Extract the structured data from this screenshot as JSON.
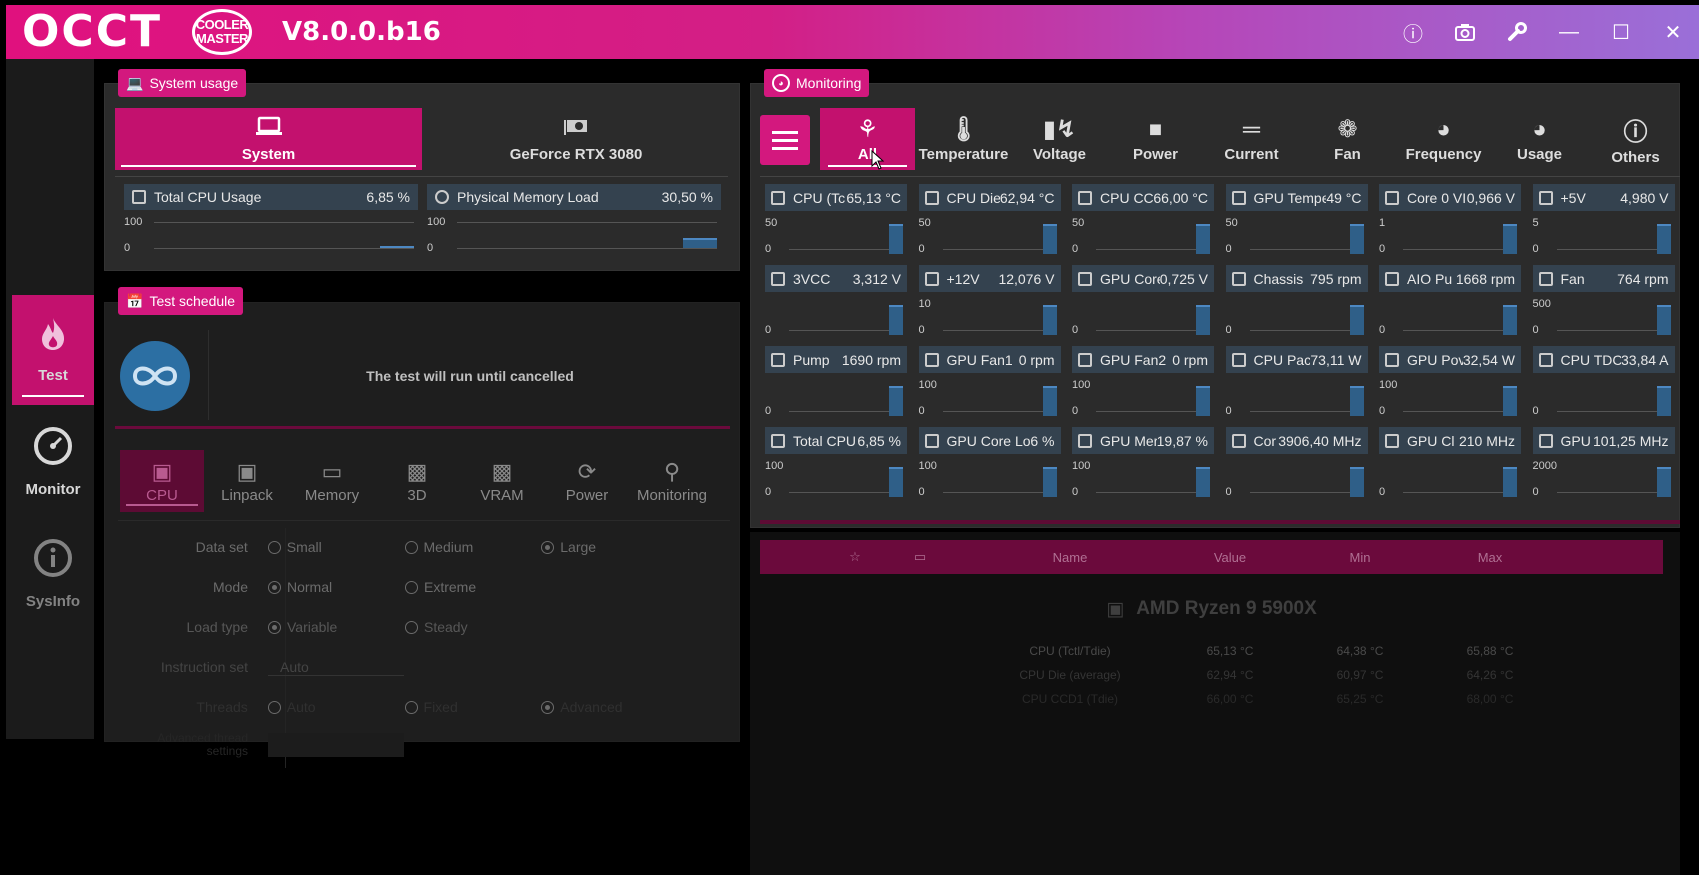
{
  "app": {
    "logo": "OCCT",
    "partner_logo": "COOLER MASTER",
    "version": "V8.0.0.b16"
  },
  "titlebar_icons": [
    "info-icon",
    "camera-icon",
    "wrench-icon",
    "minimize-icon",
    "maximize-icon",
    "close-icon"
  ],
  "sidebar": [
    {
      "label": "Test",
      "icon": "flame-icon",
      "active": true
    },
    {
      "label": "Monitor",
      "icon": "gauge-icon",
      "active": false
    },
    {
      "label": "SysInfo",
      "icon": "info-icon",
      "active": false
    }
  ],
  "system_usage": {
    "title": "System usage",
    "tabs": [
      {
        "label": "System",
        "active": true
      },
      {
        "label": "GeForce RTX 3080",
        "active": false
      }
    ],
    "meters": [
      {
        "label": "Total CPU Usage",
        "value": "6,85 %",
        "axis_max": "100",
        "axis_min": "0"
      },
      {
        "label": "Physical Memory Load",
        "value": "30,50 %",
        "axis_max": "100",
        "axis_min": "0"
      }
    ]
  },
  "test_schedule": {
    "title": "Test schedule",
    "message": "The test will run until cancelled",
    "tabs": [
      {
        "label": "CPU",
        "icon": "chip-icon",
        "active": true
      },
      {
        "label": "Linpack",
        "icon": "chip-icon"
      },
      {
        "label": "Memory",
        "icon": "memory-icon"
      },
      {
        "label": "3D",
        "icon": "gpu-icon"
      },
      {
        "label": "VRAM",
        "icon": "gpu-icon"
      },
      {
        "label": "Power",
        "icon": "power-icon"
      },
      {
        "label": "Monitoring",
        "icon": "magnifier-icon"
      }
    ],
    "options": [
      {
        "label": "Data set",
        "choices": [
          "Small",
          "Medium",
          "Large"
        ],
        "selected": "Large"
      },
      {
        "label": "Mode",
        "choices": [
          "Normal",
          "Extreme"
        ],
        "selected": "Normal"
      },
      {
        "label": "Load type",
        "choices": [
          "Variable",
          "Steady"
        ],
        "selected": "Variable"
      },
      {
        "label": "Instruction set",
        "value": "Auto"
      },
      {
        "label": "Threads",
        "choices": [
          "Auto",
          "Fixed",
          "Advanced"
        ],
        "selected": "Advanced"
      },
      {
        "label": "Advanced thread settings"
      }
    ]
  },
  "monitoring": {
    "title": "Monitoring",
    "tabs": [
      {
        "label": "All",
        "icon": "all-icon",
        "active": true
      },
      {
        "label": "Temperature",
        "icon": "thermometer-icon"
      },
      {
        "label": "Voltage",
        "icon": "battery-icon"
      },
      {
        "label": "Power",
        "icon": "plug-icon"
      },
      {
        "label": "Current",
        "icon": "current-icon"
      },
      {
        "label": "Fan",
        "icon": "fan-icon"
      },
      {
        "label": "Frequency",
        "icon": "speedometer-icon"
      },
      {
        "label": "Usage",
        "icon": "gauge-icon"
      },
      {
        "label": "Others",
        "icon": "question-icon"
      }
    ],
    "sensors": [
      {
        "label": "CPU (Tc",
        "value": "65,13 °C",
        "ax_top": "50",
        "ax_bot": "0"
      },
      {
        "label": "CPU Die",
        "value": "62,94 °C",
        "ax_top": "50",
        "ax_bot": "0"
      },
      {
        "label": "CPU CCI",
        "value": "66,00 °C",
        "ax_top": "50",
        "ax_bot": "0"
      },
      {
        "label": "GPU Tempe",
        "value": "49 °C",
        "ax_top": "50",
        "ax_bot": "0"
      },
      {
        "label": "Core 0 VI",
        "value": "0,966 V",
        "ax_top": "1",
        "ax_bot": "0"
      },
      {
        "label": "+5V",
        "value": "4,980 V",
        "ax_top": "5",
        "ax_bot": "0"
      },
      {
        "label": "3VCC",
        "value": "3,312 V",
        "ax_top": "",
        "ax_bot": "0"
      },
      {
        "label": "+12V",
        "value": "12,076 V",
        "ax_top": "10",
        "ax_bot": "0"
      },
      {
        "label": "GPU Core",
        "value": "0,725 V",
        "ax_top": "",
        "ax_bot": "0"
      },
      {
        "label": "Chassis",
        "value": "795 rpm",
        "ax_top": "",
        "ax_bot": "0"
      },
      {
        "label": "AIO Pu",
        "value": "1668 rpm",
        "ax_top": "",
        "ax_bot": "0"
      },
      {
        "label": "Fan",
        "value": "764 rpm",
        "ax_top": "500",
        "ax_bot": "0"
      },
      {
        "label": "Pump",
        "value": "1690 rpm",
        "ax_top": "",
        "ax_bot": "0"
      },
      {
        "label": "GPU Fan1",
        "value": "0 rpm",
        "ax_top": "100",
        "ax_bot": "0"
      },
      {
        "label": "GPU Fan2",
        "value": "0 rpm",
        "ax_top": "100",
        "ax_bot": "0"
      },
      {
        "label": "CPU Pac",
        "value": "73,11 W",
        "ax_top": "",
        "ax_bot": "0"
      },
      {
        "label": "GPU Pov",
        "value": "32,54 W",
        "ax_top": "100",
        "ax_bot": "0"
      },
      {
        "label": "CPU TDC",
        "value": "33,84 A",
        "ax_top": "",
        "ax_bot": "0"
      },
      {
        "label": "Total CPU",
        "value": "6,85 %",
        "ax_top": "100",
        "ax_bot": "0"
      },
      {
        "label": "GPU Core Lo",
        "value": "6 %",
        "ax_top": "100",
        "ax_bot": "0"
      },
      {
        "label": "GPU Mer",
        "value": "19,87 %",
        "ax_top": "100",
        "ax_bot": "0"
      },
      {
        "label": "Cor",
        "value": "3906,40 MHz",
        "ax_top": "",
        "ax_bot": "0"
      },
      {
        "label": "GPU Cl",
        "value": "210 MHz",
        "ax_top": "",
        "ax_bot": "0"
      },
      {
        "label": "GPU",
        "value": "101,25 MHz",
        "ax_top": "2000",
        "ax_bot": "0"
      }
    ],
    "table": {
      "headers": [
        "Name",
        "Value",
        "Min",
        "Max"
      ],
      "device": "AMD Ryzen 9 5900X",
      "rows": [
        {
          "name": "CPU (Tctl/Tdie)",
          "value": "65,13 °C",
          "min": "64,38 °C",
          "max": "65,88 °C"
        },
        {
          "name": "CPU Die (average)",
          "value": "62,94 °C",
          "min": "60,97 °C",
          "max": "64,26 °C"
        },
        {
          "name": "CPU CCD1 (Tdie)",
          "value": "66,00 °C",
          "min": "65,25 °C",
          "max": "68,00 °C"
        }
      ]
    }
  }
}
